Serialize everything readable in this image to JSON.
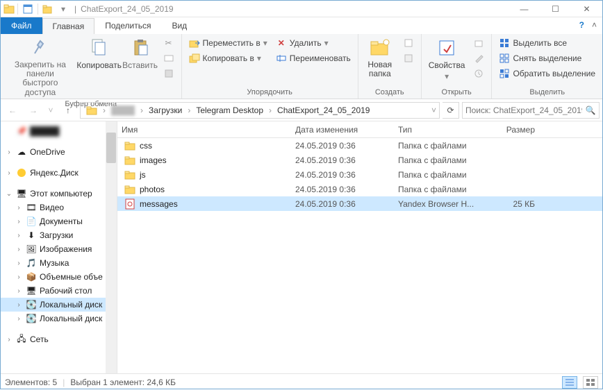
{
  "window": {
    "title": "ChatExport_24_05_2019"
  },
  "tabs": {
    "file": "Файл",
    "home": "Главная",
    "share": "Поделиться",
    "view": "Вид"
  },
  "ribbon": {
    "pin": "Закрепить на панели\nбыстрого доступа",
    "copy": "Копировать",
    "paste": "Вставить",
    "clipboard_group": "Буфер обмена",
    "move_to": "Переместить в",
    "copy_to": "Копировать в",
    "delete": "Удалить",
    "rename": "Переименовать",
    "organize_group": "Упорядочить",
    "new_folder": "Новая\nпапка",
    "create_group": "Создать",
    "properties": "Свойства",
    "open_group": "Открыть",
    "select_all": "Выделить все",
    "select_none": "Снять выделение",
    "invert_selection": "Обратить выделение",
    "select_group": "Выделить"
  },
  "breadcrumb": {
    "seg1": "Загрузки",
    "seg2": "Telegram Desktop",
    "seg3": "ChatExport_24_05_2019"
  },
  "search": {
    "placeholder": "Поиск: ChatExport_24_05_2019"
  },
  "columns": {
    "name": "Имя",
    "date": "Дата изменения",
    "type": "Тип",
    "size": "Размер"
  },
  "files": [
    {
      "name": "css",
      "date": "24.05.2019 0:36",
      "type": "Папка с файлами",
      "size": "",
      "kind": "folder"
    },
    {
      "name": "images",
      "date": "24.05.2019 0:36",
      "type": "Папка с файлами",
      "size": "",
      "kind": "folder"
    },
    {
      "name": "js",
      "date": "24.05.2019 0:36",
      "type": "Папка с файлами",
      "size": "",
      "kind": "folder"
    },
    {
      "name": "photos",
      "date": "24.05.2019 0:36",
      "type": "Папка с файлами",
      "size": "",
      "kind": "folder"
    },
    {
      "name": "messages",
      "date": "24.05.2019 0:36",
      "type": "Yandex Browser H...",
      "size": "25 КБ",
      "kind": "html",
      "selected": true
    }
  ],
  "nav": {
    "onedrive": "OneDrive",
    "yandex": "Яндекс.Диск",
    "thispc": "Этот компьютер",
    "video": "Видео",
    "documents": "Документы",
    "downloads": "Загрузки",
    "pictures": "Изображения",
    "music": "Музыка",
    "volumes": "Объемные объе",
    "desktop": "Рабочий стол",
    "localdisk1": "Локальный диск",
    "localdisk2": "Локальный диск",
    "network": "Сеть"
  },
  "status": {
    "count": "Элементов: 5",
    "selection": "Выбран 1 элемент: 24,6 КБ"
  }
}
